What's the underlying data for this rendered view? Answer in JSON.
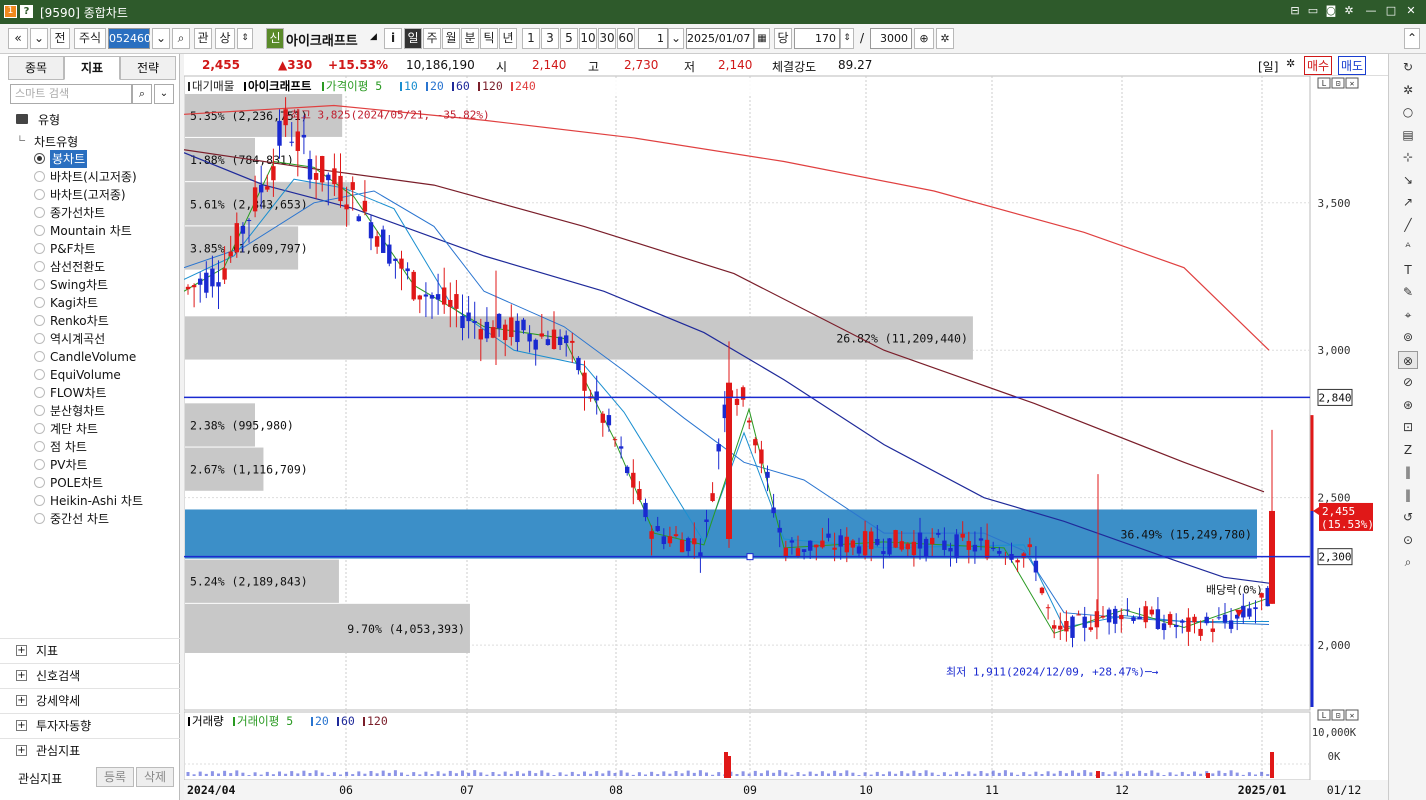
{
  "window": {
    "title": "[9590] 종합차트",
    "icons": [
      "pin-icon",
      "memo-icon",
      "camera-icon",
      "gear-icon",
      "minimize-icon",
      "maximize-icon",
      "close-icon"
    ]
  },
  "toolbar": {
    "prev": "«",
    "down": "≫",
    "full": "전",
    "type": "주식",
    "code": "052460",
    "mag": "⌕",
    "watch": "관",
    "up": "상",
    "new_badge": "신",
    "stock_name": "아이크래프트",
    "info": "i",
    "periods": [
      "일",
      "주",
      "월",
      "분",
      "틱",
      "년"
    ],
    "multipliers": [
      "1",
      "3",
      "5",
      "10",
      "30",
      "60"
    ],
    "interval": "1",
    "date": "2025/01/07",
    "unit": "당",
    "count": "170",
    "slash": "/",
    "total": "3000"
  },
  "sidebar": {
    "tabs": [
      "종목",
      "지표",
      "전략"
    ],
    "search_placeholder": "스마트 검색",
    "group_title": "유형",
    "subgroup": "차트유형",
    "chart_types": [
      "봉차트",
      "바차트(시고저종)",
      "바차트(고저종)",
      "종가선차트",
      "Mountain 차트",
      "P&F차트",
      "삼선전환도",
      "Swing차트",
      "Kagi차트",
      "Renko차트",
      "역시계곡선",
      "CandleVolume",
      "EquiVolume",
      "FLOW차트",
      "분산형차트",
      "계단 차트",
      "점 차트",
      "PV차트",
      "POLE차트",
      "Heikin-Ashi 차트",
      "중간선 차트"
    ],
    "sections": [
      "지표",
      "신호검색",
      "강세약세",
      "투자자동향",
      "관심지표"
    ],
    "footer": {
      "label": "관심지표",
      "register": "등록",
      "delete": "삭제"
    }
  },
  "quote": {
    "price": "2,455",
    "change": "▲330",
    "rate": "+15.53%",
    "volume": "10,186,190",
    "open_label": "시",
    "open": "2,140",
    "high_label": "고",
    "high": "2,730",
    "low_label": "저",
    "low": "2,140",
    "strength_label": "체결강도",
    "strength": "89.27",
    "period_badge": "[일]",
    "buy": "매수",
    "sell": "매도"
  },
  "legend": {
    "items": [
      {
        "text": "대기매물",
        "color": "#222"
      },
      {
        "text": "아이크래프트",
        "color": "#000"
      },
      {
        "text": "가격이평 5",
        "color": "#2a9a22"
      },
      {
        "text": "10",
        "color": "#1a8fd0"
      },
      {
        "text": "20",
        "color": "#2a75d0"
      },
      {
        "text": "60",
        "color": "#1f2a9a"
      },
      {
        "text": "120",
        "color": "#7a1e2a"
      },
      {
        "text": "240",
        "color": "#e04040"
      }
    ]
  },
  "volume_legend": {
    "items": [
      {
        "text": "거래량",
        "color": "#000"
      },
      {
        "text": "거래이평 5",
        "color": "#2a9a22"
      },
      {
        "text": "20",
        "color": "#2a75d0"
      },
      {
        "text": "60",
        "color": "#1f2a9a"
      },
      {
        "text": "120",
        "color": "#7a1e2a"
      }
    ],
    "ticks": [
      "10,000K",
      "0K"
    ]
  },
  "chart_data": {
    "type": "candlestick",
    "y_axis": {
      "min": 1780,
      "max": 3930,
      "ticks": [
        2000,
        2500,
        3000,
        3500
      ],
      "tick_labels": [
        "2,000",
        "2,500",
        "3,000",
        "3,500"
      ]
    },
    "x_axis_labels": [
      "2024/04",
      "06",
      "07",
      "08",
      "09",
      "10",
      "11",
      "12",
      "2025/01",
      "01/12"
    ],
    "annotations": {
      "high": "최고 3,825(2024/05/21, -35.82%)",
      "low": "최저 1,911(2024/12/09, +28.47%)",
      "dividend": "배당락(0%)"
    },
    "price_tags": [
      {
        "value": 2840,
        "label": "2,840"
      },
      {
        "value": 2300,
        "label": "2,300"
      },
      {
        "value": 2455,
        "label": "2,455",
        "sub": "(15.53%)"
      }
    ],
    "volume_profile": [
      {
        "low": 3720,
        "high": 3870,
        "label": "5.35% (2,236,751)"
      },
      {
        "low": 3570,
        "high": 3720,
        "label": "1.88% (784,831)"
      },
      {
        "low": 3420,
        "high": 3570,
        "label": "5.61% (2,343,653)"
      },
      {
        "low": 3270,
        "high": 3420,
        "label": "3.85% (1,609,797)"
      },
      {
        "low": 2965,
        "high": 3115,
        "label": "26.82% (11,209,440)"
      },
      {
        "low": 2670,
        "high": 2820,
        "label": "2.38% (995,980)"
      },
      {
        "low": 2520,
        "high": 2670,
        "label": "2.67% (1,116,709)"
      },
      {
        "low": 2290,
        "high": 2460,
        "label": "36.49% (15,249,780)"
      },
      {
        "low": 2140,
        "high": 2290,
        "label": "5.24% (2,189,843)"
      },
      {
        "low": 1970,
        "high": 2140,
        "label": "9.70% (4,053,393)"
      }
    ]
  }
}
